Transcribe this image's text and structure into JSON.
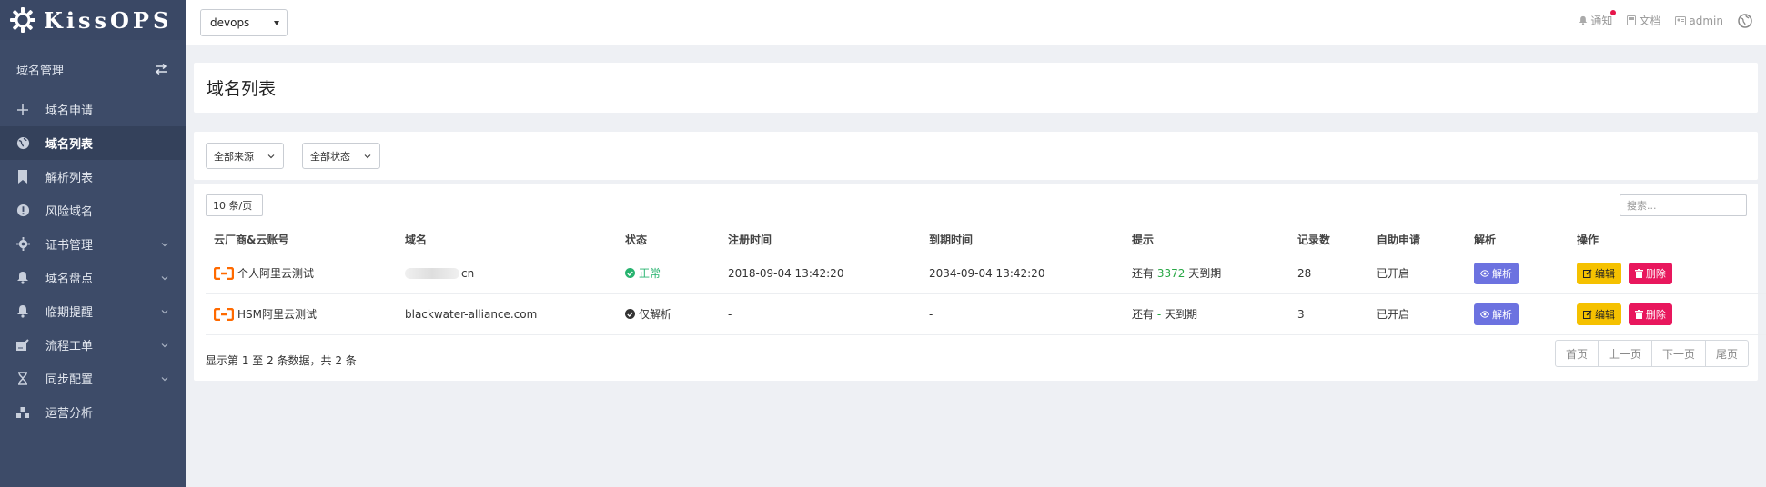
{
  "app": {
    "title": "KissOPS"
  },
  "sidebar": {
    "group_label": "域名管理",
    "items": [
      {
        "label": "域名申请",
        "icon": "plus-icon",
        "active": false,
        "has_children": false
      },
      {
        "label": "域名列表",
        "icon": "globe-icon",
        "active": true,
        "has_children": false
      },
      {
        "label": "解析列表",
        "icon": "bookmark-icon",
        "active": false,
        "has_children": false
      },
      {
        "label": "风险域名",
        "icon": "alert-icon",
        "active": false,
        "has_children": false
      },
      {
        "label": "证书管理",
        "icon": "gear-icon",
        "active": false,
        "has_children": true
      },
      {
        "label": "域名盘点",
        "icon": "bell-icon",
        "active": false,
        "has_children": true
      },
      {
        "label": "临期提醒",
        "icon": "bell-icon",
        "active": false,
        "has_children": true
      },
      {
        "label": "流程工单",
        "icon": "signature-icon",
        "active": false,
        "has_children": true
      },
      {
        "label": "同步配置",
        "icon": "hourglass-icon",
        "active": false,
        "has_children": true
      },
      {
        "label": "运营分析",
        "icon": "cubes-icon",
        "active": false,
        "has_children": false
      }
    ]
  },
  "topbar": {
    "env_value": "devops",
    "notify_label": "通知",
    "docs_label": "文档",
    "user_label": "admin"
  },
  "page": {
    "title": "域名列表",
    "filters": {
      "source": "全部来源",
      "status": "全部状态"
    },
    "page_size": "10 条/页",
    "search_placeholder": "搜索..."
  },
  "table": {
    "headers": [
      "云厂商&云账号",
      "域名",
      "状态",
      "注册时间",
      "到期时间",
      "提示",
      "记录数",
      "自助申请",
      "解析",
      "操作"
    ],
    "rows": [
      {
        "vendor": "个人阿里云测试",
        "domain": "cn",
        "domain_obscured": true,
        "status": "正常",
        "status_type": "ok",
        "registered": "2018-09-04 13:42:20",
        "expires": "2034-09-04 13:42:20",
        "hint_prefix": "还有",
        "hint_days": "3372",
        "hint_suffix": "天到期",
        "records": "28",
        "self_service": "已开启"
      },
      {
        "vendor": "HSM阿里云测试",
        "domain": "blackwater-alliance.com",
        "domain_obscured": false,
        "status": "仅解析",
        "status_type": "dns",
        "registered": "-",
        "expires": "-",
        "hint_prefix": "还有",
        "hint_days": "-",
        "hint_suffix": "天到期",
        "records": "3",
        "self_service": "已开启"
      }
    ],
    "actions": {
      "dns": "解析",
      "edit": "编辑",
      "delete": "删除"
    }
  },
  "footer": {
    "summary": "显示第 1 至 2 条数据，共 2 条",
    "pager": [
      "首页",
      "上一页",
      "下一页",
      "尾页"
    ]
  },
  "colors": {
    "sidebar": "#3d4b68",
    "accent_green": "#28a745",
    "btn_purple": "#6c72e0",
    "btn_yellow": "#f5c100",
    "btn_red": "#e8175d",
    "vendor_orange": "#ff6a00"
  }
}
